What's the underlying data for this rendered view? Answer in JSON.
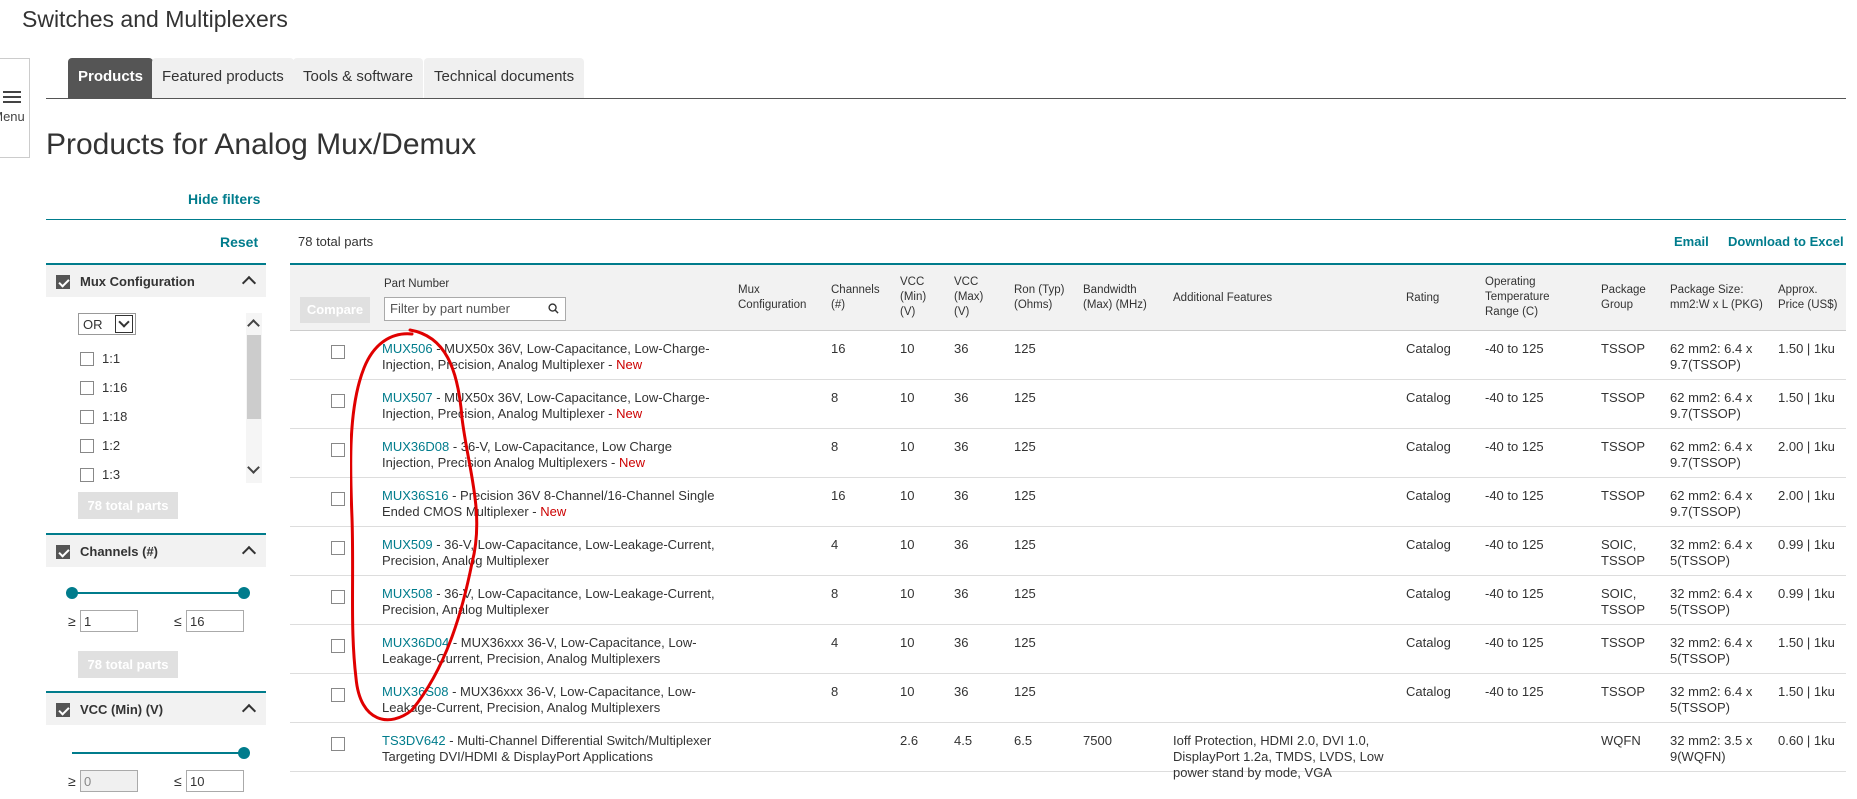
{
  "header": {
    "title": "Switches and Multiplexers"
  },
  "menu": {
    "label": "Menu"
  },
  "tabs": [
    {
      "label": "Products",
      "active": true
    },
    {
      "label": "Featured products",
      "active": false
    },
    {
      "label": "Tools & software",
      "active": false
    },
    {
      "label": "Technical documents",
      "active": false
    }
  ],
  "main": {
    "title": "Products for Analog Mux/Demux",
    "hide_filters": "Hide filters",
    "reset": "Reset",
    "total_parts": "78 total parts",
    "email": "Email",
    "download": "Download to Excel"
  },
  "filters": {
    "mux_config": {
      "title": "Mux Configuration",
      "operator": "OR",
      "options": [
        "1:1",
        "1:16",
        "1:18",
        "1:2",
        "1:3"
      ],
      "total_button": "78 total parts"
    },
    "channels": {
      "title": "Channels (#)",
      "ge_symbol": "≥",
      "le_symbol": "≤",
      "min": "1",
      "max": "16",
      "total_button": "78 total parts"
    },
    "vcc_min": {
      "title": "VCC (Min) (V)",
      "ge_symbol": "≥",
      "le_symbol": "≤",
      "min": "0",
      "max": "10"
    }
  },
  "table": {
    "compare_label": "Compare",
    "filter_placeholder": "Filter by part number",
    "headers": {
      "part_number": "Part Number",
      "mux_config": "Mux\nConfiguration",
      "channels": "Channels\n(#)",
      "vcc_min": "VCC\n(Min)\n(V)",
      "vcc_max": "VCC\n(Max)\n(V)",
      "ron": "Ron (Typ)\n(Ohms)",
      "bandwidth": "Bandwidth\n(Max) (MHz)",
      "additional": "Additional Features",
      "rating": "Rating",
      "op_temp": "Operating\nTemperature\nRange (C)",
      "package_group": "Package\nGroup",
      "package_size": "Package Size:\nmm2:W x L (PKG)",
      "price": "Approx.\nPrice (US$)"
    },
    "rows": [
      {
        "part": "MUX506",
        "desc": " - MUX50x 36V, Low-Capacitance, Low-Charge-Injection, Precision, Analog Multiplexer - ",
        "new": "New",
        "mux": "",
        "channels": "16",
        "vcc_min": "10",
        "vcc_max": "36",
        "ron": "125",
        "bandwidth": "",
        "features": "",
        "rating": "Catalog",
        "temp": "-40 to 125",
        "pkg_group": "TSSOP",
        "pkg_size": "62 mm2: 6.4 x 9.7(TSSOP)",
        "price": "1.50 | 1ku"
      },
      {
        "part": "MUX507",
        "desc": " - MUX50x 36V, Low-Capacitance, Low-Charge-Injection, Precision, Analog Multiplexer - ",
        "new": "New",
        "mux": "",
        "channels": "8",
        "vcc_min": "10",
        "vcc_max": "36",
        "ron": "125",
        "bandwidth": "",
        "features": "",
        "rating": "Catalog",
        "temp": "-40 to 125",
        "pkg_group": "TSSOP",
        "pkg_size": "62 mm2: 6.4 x 9.7(TSSOP)",
        "price": "1.50 | 1ku"
      },
      {
        "part": "MUX36D08",
        "desc": " - 36-V, Low-Capacitance, Low Charge Injection, Precision Analog Multiplexers - ",
        "new": "New",
        "mux": "",
        "channels": "8",
        "vcc_min": "10",
        "vcc_max": "36",
        "ron": "125",
        "bandwidth": "",
        "features": "",
        "rating": "Catalog",
        "temp": "-40 to 125",
        "pkg_group": "TSSOP",
        "pkg_size": "62 mm2: 6.4 x 9.7(TSSOP)",
        "price": "2.00 | 1ku"
      },
      {
        "part": "MUX36S16",
        "desc": " - Precision 36V 8-Channel/16-Channel Single Ended CMOS Multiplexer - ",
        "new": "New",
        "mux": "",
        "channels": "16",
        "vcc_min": "10",
        "vcc_max": "36",
        "ron": "125",
        "bandwidth": "",
        "features": "",
        "rating": "Catalog",
        "temp": "-40 to 125",
        "pkg_group": "TSSOP",
        "pkg_size": "62 mm2: 6.4 x 9.7(TSSOP)",
        "price": "2.00 | 1ku"
      },
      {
        "part": "MUX509",
        "desc": " - 36-V, Low-Capacitance, Low-Leakage-Current, Precision, Analog Multiplexer",
        "new": "",
        "mux": "",
        "channels": "4",
        "vcc_min": "10",
        "vcc_max": "36",
        "ron": "125",
        "bandwidth": "",
        "features": "",
        "rating": "Catalog",
        "temp": "-40 to 125",
        "pkg_group": "SOIC, TSSOP",
        "pkg_size": "32 mm2: 6.4 x 5(TSSOP)",
        "price": "0.99 | 1ku"
      },
      {
        "part": "MUX508",
        "desc": " - 36-V, Low-Capacitance, Low-Leakage-Current, Precision, Analog Multiplexer",
        "new": "",
        "mux": "",
        "channels": "8",
        "vcc_min": "10",
        "vcc_max": "36",
        "ron": "125",
        "bandwidth": "",
        "features": "",
        "rating": "Catalog",
        "temp": "-40 to 125",
        "pkg_group": "SOIC, TSSOP",
        "pkg_size": "32 mm2: 6.4 x 5(TSSOP)",
        "price": "0.99 | 1ku"
      },
      {
        "part": "MUX36D04",
        "desc": " - MUX36xxx 36-V, Low-Capacitance, Low-Leakage-Current, Precision, Analog Multiplexers",
        "new": "",
        "mux": "",
        "channels": "4",
        "vcc_min": "10",
        "vcc_max": "36",
        "ron": "125",
        "bandwidth": "",
        "features": "",
        "rating": "Catalog",
        "temp": "-40 to 125",
        "pkg_group": "TSSOP",
        "pkg_size": "32 mm2: 6.4 x 5(TSSOP)",
        "price": "1.50 | 1ku"
      },
      {
        "part": "MUX36S08",
        "desc": " - MUX36xxx 36-V, Low-Capacitance, Low-Leakage-Current, Precision, Analog Multiplexers",
        "new": "",
        "mux": "",
        "channels": "8",
        "vcc_min": "10",
        "vcc_max": "36",
        "ron": "125",
        "bandwidth": "",
        "features": "",
        "rating": "Catalog",
        "temp": "-40 to 125",
        "pkg_group": "TSSOP",
        "pkg_size": "32 mm2: 6.4 x 5(TSSOP)",
        "price": "1.50 | 1ku"
      },
      {
        "part": "TS3DV642",
        "desc": " - Multi-Channel Differential Switch/Multiplexer Targeting DVI/HDMI & DisplayPort Applications",
        "new": "",
        "mux": "",
        "channels": "",
        "vcc_min": "2.6",
        "vcc_max": "4.5",
        "ron": "6.5",
        "bandwidth": "7500",
        "features": "Ioff Protection, HDMI 2.0, DVI 1.0, DisplayPort 1.2a, TMDS, LVDS, Low power stand by mode, VGA",
        "rating": "",
        "temp": "",
        "pkg_group": "WQFN",
        "pkg_size": "32 mm2: 3.5 x 9(WQFN)",
        "price": "0.60 | 1ku"
      }
    ]
  },
  "colors": {
    "accent": "#007c8c",
    "new": "#cc0000",
    "annotation": "#e00000"
  }
}
